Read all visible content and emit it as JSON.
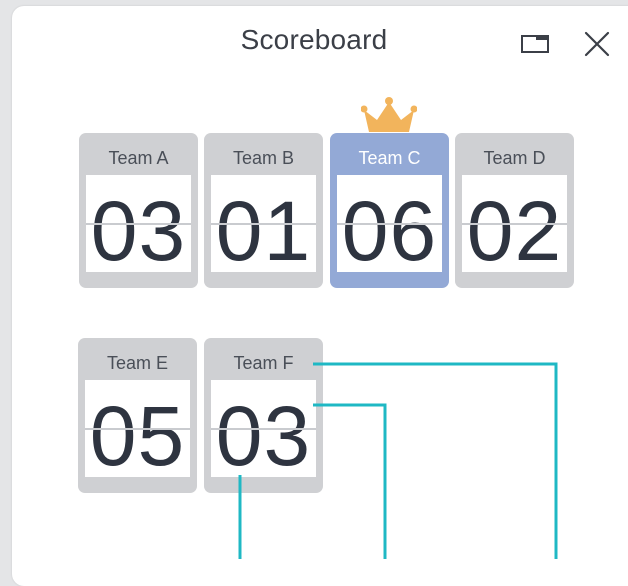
{
  "window": {
    "title": "Scoreboard",
    "minimize_icon": "window-minimize-icon",
    "close_icon": "close-icon"
  },
  "colors": {
    "card_default": "#cfd0d3",
    "card_leader": "#93a9d6",
    "crown": "#f2b45c",
    "callout": "#1fb8c4"
  },
  "teams": [
    {
      "name": "Team A",
      "score": "03",
      "leader": false
    },
    {
      "name": "Team B",
      "score": "01",
      "leader": false
    },
    {
      "name": "Team C",
      "score": "06",
      "leader": true
    },
    {
      "name": "Team D",
      "score": "02",
      "leader": false
    },
    {
      "name": "Team E",
      "score": "05",
      "leader": false
    },
    {
      "name": "Team F",
      "score": "03",
      "leader": false
    }
  ],
  "leader_icon": "crown-icon"
}
